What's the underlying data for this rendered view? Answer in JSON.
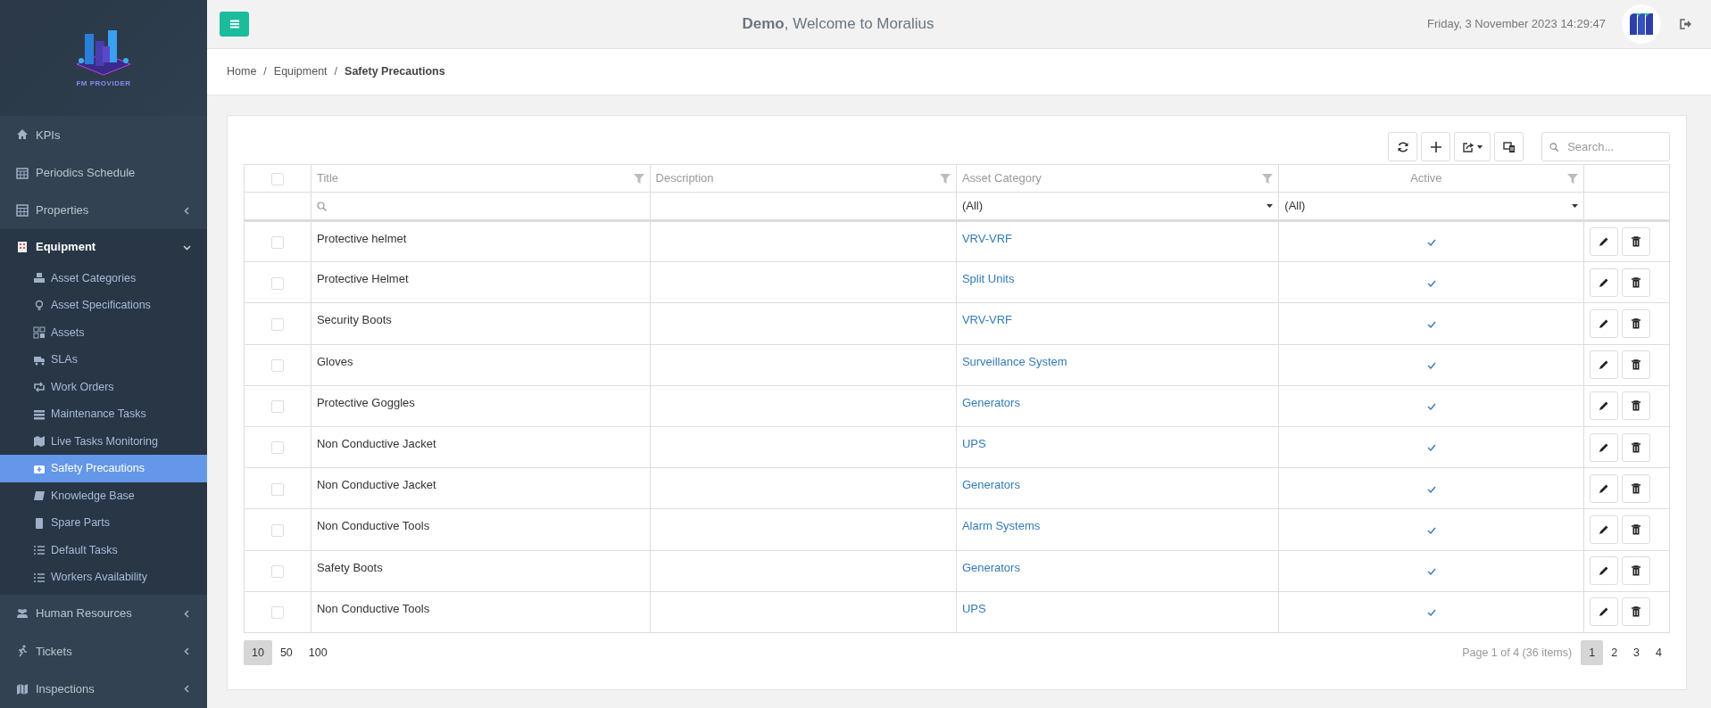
{
  "sidebar": {
    "logo_text": "FM PROVIDER",
    "items": [
      {
        "label": "KPIs",
        "kind": "link",
        "selected": false
      },
      {
        "label": "Periodics Schedule",
        "kind": "link",
        "selected": false
      },
      {
        "label": "Properties",
        "kind": "menu",
        "expanded": false,
        "selected": false
      },
      {
        "label": "Equipment",
        "kind": "menu",
        "expanded": true,
        "selected": false,
        "children": [
          {
            "label": "Asset Categories",
            "selected": false
          },
          {
            "label": "Asset Specifications",
            "selected": false
          },
          {
            "label": "Assets",
            "selected": false
          },
          {
            "label": "SLAs",
            "selected": false
          },
          {
            "label": "Work Orders",
            "selected": false
          },
          {
            "label": "Maintenance Tasks",
            "selected": false
          },
          {
            "label": "Live Tasks Monitoring",
            "selected": false
          },
          {
            "label": "Safety Precautions",
            "selected": true
          },
          {
            "label": "Knowledge Base",
            "selected": false
          },
          {
            "label": "Spare Parts",
            "selected": false
          },
          {
            "label": "Default Tasks",
            "selected": false
          },
          {
            "label": "Workers Availability",
            "selected": false
          }
        ]
      },
      {
        "label": "Human Resources",
        "kind": "menu",
        "expanded": false,
        "selected": false
      },
      {
        "label": "Tickets",
        "kind": "menu",
        "expanded": false,
        "selected": false
      },
      {
        "label": "Inspections",
        "kind": "menu",
        "expanded": false,
        "selected": false
      }
    ]
  },
  "header": {
    "welcome": "**Demo**, Welcome to Moralius",
    "datetime": "Friday, 3 November 2023 14:29:47"
  },
  "breadcrumb": [
    {
      "label": "Home",
      "current": false
    },
    {
      "separator": "/",
      "label": "Equipment",
      "current": false
    },
    {
      "separator": "/",
      "label": "Safety Precautions",
      "current": true
    }
  ],
  "toolbar": {
    "search_placeholder": "Search..."
  },
  "table": {
    "select_all_checked": false,
    "columns": [
      {
        "label": "Title",
        "kind": "search"
      },
      {
        "label": "Description",
        "kind": "blank"
      },
      {
        "label": "Asset Category",
        "kind": "select",
        "filter_value": "(All)"
      },
      {
        "label": "Active",
        "kind": "select",
        "filter_value": "(All)"
      }
    ],
    "rows": [
      {
        "checked": false,
        "title": "Protective helmet",
        "asset_category": "VRV-VRF",
        "active": true
      },
      {
        "checked": false,
        "title": "Protective Helmet",
        "asset_category": "Split Units",
        "active": true
      },
      {
        "checked": false,
        "title": "Security Boots",
        "asset_category": "VRV-VRF",
        "active": true
      },
      {
        "checked": false,
        "title": "Gloves",
        "asset_category": "Surveillance System",
        "active": true
      },
      {
        "checked": false,
        "title": "Protective Goggles",
        "asset_category": "Generators",
        "active": true
      },
      {
        "checked": false,
        "title": "Non Conductive Jacket",
        "asset_category": "UPS",
        "active": true
      },
      {
        "checked": false,
        "title": "Non Conductive Jacket",
        "asset_category": "Generators",
        "active": true
      },
      {
        "checked": false,
        "title": "Non Conductive Tools",
        "asset_category": "Alarm Systems",
        "active": true
      },
      {
        "checked": false,
        "title": "Safety Boots",
        "asset_category": "Generators",
        "active": true
      },
      {
        "checked": false,
        "title": "Non Conductive Tools",
        "asset_category": "UPS",
        "active": true
      }
    ]
  },
  "pager": {
    "sizes": [
      {
        "label": "10",
        "selected": true
      },
      {
        "label": "50",
        "selected": false
      },
      {
        "label": "100",
        "selected": false
      }
    ],
    "info": "Page 1 of 4 (36 items)",
    "pages": [
      {
        "label": "1",
        "selected": true
      },
      {
        "label": "2",
        "selected": false
      },
      {
        "label": "3",
        "selected": false
      },
      {
        "label": "4",
        "selected": false
      }
    ]
  }
}
